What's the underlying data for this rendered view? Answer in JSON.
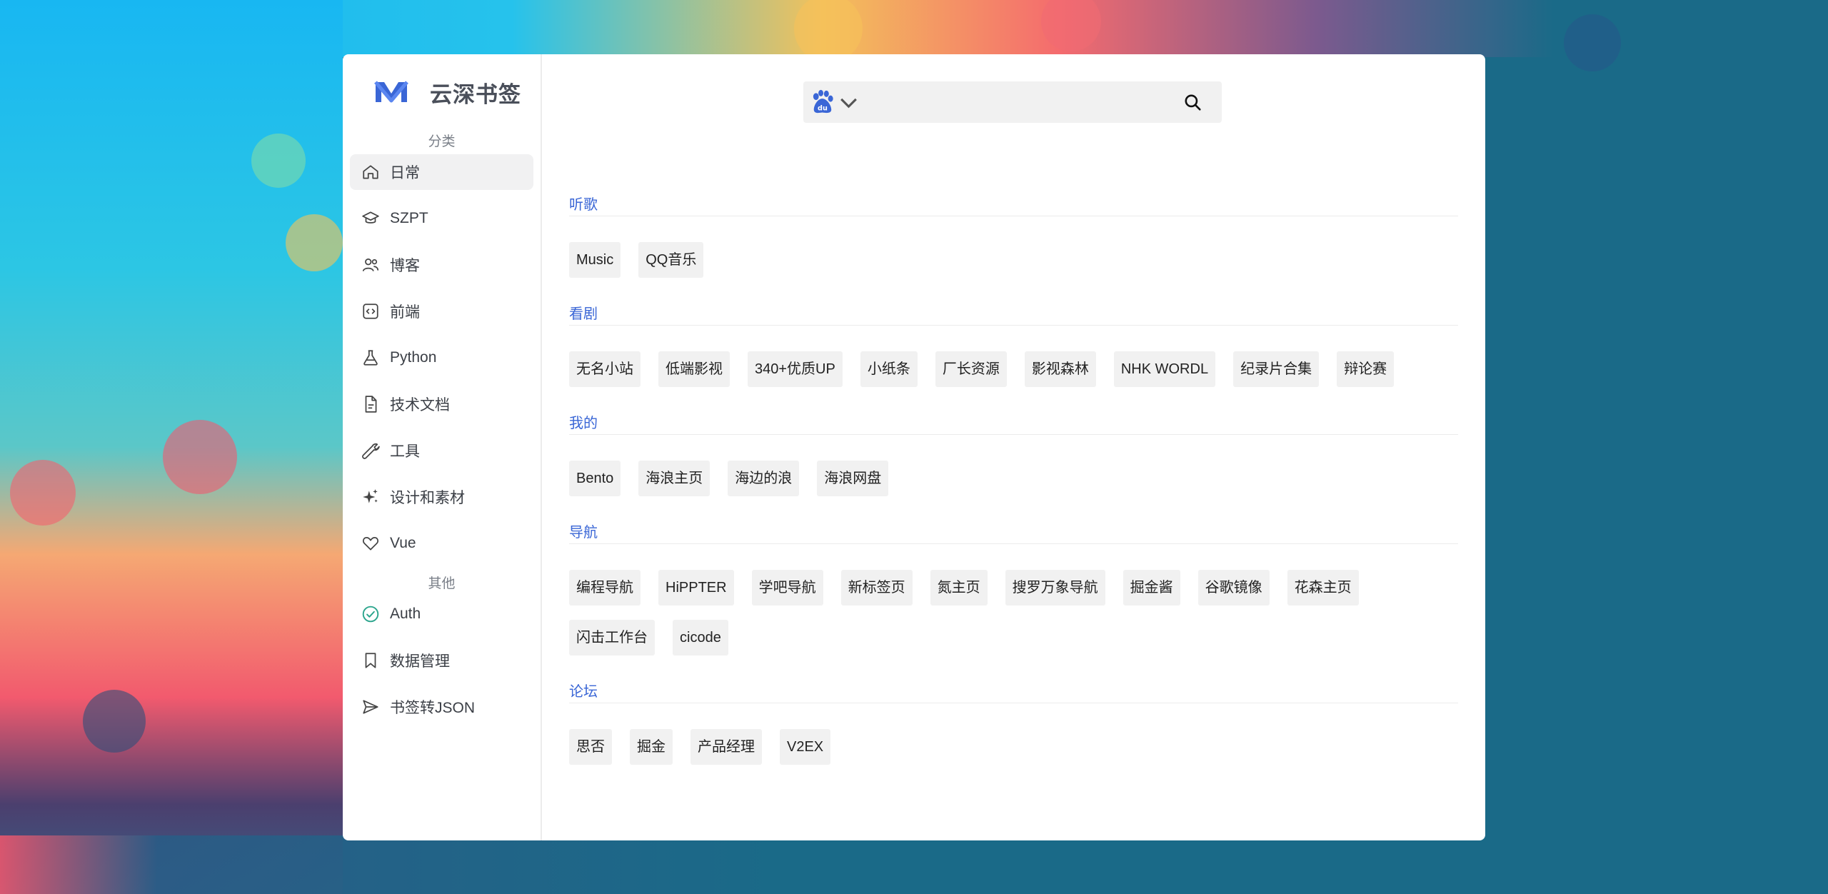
{
  "brand": {
    "title": "云深书签",
    "logo_icon": "m-logo-icon",
    "accent": "#3a66d6"
  },
  "sidebar": {
    "section_category": "分类",
    "section_other": "其他",
    "items": [
      {
        "label": "日常",
        "icon": "home-icon",
        "active": true
      },
      {
        "label": "SZPT",
        "icon": "graduation-cap-icon"
      },
      {
        "label": "博客",
        "icon": "users-icon"
      },
      {
        "label": "前端",
        "icon": "code-icon"
      },
      {
        "label": "Python",
        "icon": "flask-icon"
      },
      {
        "label": "技术文档",
        "icon": "document-icon"
      },
      {
        "label": "工具",
        "icon": "wrench-icon"
      },
      {
        "label": "设计和素材",
        "icon": "sparkles-icon"
      },
      {
        "label": "Vue",
        "icon": "heart-icon"
      }
    ],
    "other_items": [
      {
        "label": "Auth",
        "icon": "check-circle-icon",
        "color": "#2ca58d"
      },
      {
        "label": "数据管理",
        "icon": "bookmark-icon"
      },
      {
        "label": "书签转JSON",
        "icon": "send-icon"
      }
    ]
  },
  "search": {
    "engine_icon": "baidu-paw-icon",
    "value": "",
    "placeholder": ""
  },
  "groups": [
    {
      "title": "听歌",
      "links": [
        "Music",
        "QQ音乐"
      ]
    },
    {
      "title": "看剧",
      "links": [
        "无名小站",
        "低端影视",
        "340+优质UP",
        "小纸条",
        "厂长资源",
        "影视森林",
        "NHK WORDL",
        "纪录片合集",
        "辩论赛"
      ]
    },
    {
      "title": "我的",
      "links": [
        "Bento",
        "海浪主页",
        "海边的浪",
        "海浪网盘"
      ]
    },
    {
      "title": "导航",
      "links": [
        "编程导航",
        "HiPPTER",
        "学吧导航",
        "新标签页",
        "氮主页",
        "搜罗万象导航",
        "掘金酱",
        "谷歌镜像",
        "花森主页",
        "闪击工作台",
        "cicode"
      ]
    },
    {
      "title": "论坛",
      "links": [
        "思否",
        "掘金",
        "产品经理",
        "V2EX"
      ]
    }
  ]
}
